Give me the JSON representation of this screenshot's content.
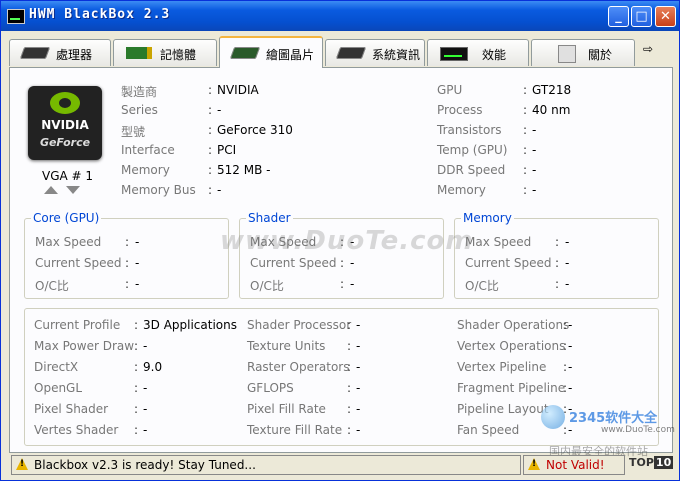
{
  "window": {
    "title": "HWM BlackBox 2.3"
  },
  "tabs": [
    {
      "label": "處理器",
      "icon": "cpu-chip-icon"
    },
    {
      "label": "記憶體",
      "icon": "ram-module-icon"
    },
    {
      "label": "繪圖晶片",
      "icon": "gpu-card-icon",
      "active": true
    },
    {
      "label": "系統資訊",
      "icon": "motherboard-icon"
    },
    {
      "label": "效能",
      "icon": "performance-monitor-icon"
    },
    {
      "label": "關於",
      "icon": "about-document-icon"
    }
  ],
  "gpu_header": {
    "logo_line1": "NVIDIA",
    "logo_line2": "GeForce",
    "vga_label": "VGA # 1",
    "left": [
      {
        "label": "製造商",
        "value": "NVIDIA"
      },
      {
        "label": "Series",
        "value": "-"
      },
      {
        "label": "型號",
        "value": "GeForce 310"
      },
      {
        "label": "Interface",
        "value": "PCI"
      },
      {
        "label": "Memory",
        "value": "512 MB -"
      },
      {
        "label": "Memory Bus",
        "value": "-"
      }
    ],
    "right": [
      {
        "label": "GPU",
        "value": "GT218"
      },
      {
        "label": "Process",
        "value": "40 nm"
      },
      {
        "label": "Transistors",
        "value": "-"
      },
      {
        "label": "Temp (GPU)",
        "value": "-"
      },
      {
        "label": "DDR Speed",
        "value": "-"
      },
      {
        "label": "Memory",
        "value": "-"
      }
    ]
  },
  "clock_groups": [
    {
      "title": "Core (GPU)",
      "rows": [
        {
          "label": "Max Speed",
          "value": "-"
        },
        {
          "label": "Current Speed",
          "value": "-"
        },
        {
          "label": "O/C比",
          "value": "-"
        }
      ]
    },
    {
      "title": "Shader",
      "rows": [
        {
          "label": "Max Speed",
          "value": "-"
        },
        {
          "label": "Current Speed",
          "value": "-"
        },
        {
          "label": "O/C比",
          "value": "-"
        }
      ]
    },
    {
      "title": "Memory",
      "rows": [
        {
          "label": "Max Speed",
          "value": "-"
        },
        {
          "label": "Current Speed",
          "value": "-"
        },
        {
          "label": "O/C比",
          "value": "-"
        }
      ]
    }
  ],
  "details": [
    [
      {
        "label": "Current Profile",
        "value": "3D Applications"
      },
      {
        "label": "Max Power Draw",
        "value": "-"
      },
      {
        "label": "DirectX",
        "value": "9.0"
      },
      {
        "label": "OpenGL",
        "value": "-"
      },
      {
        "label": "Pixel Shader",
        "value": "-"
      },
      {
        "label": "Vertes Shader",
        "value": "-"
      }
    ],
    [
      {
        "label": "Shader Processor",
        "value": "-"
      },
      {
        "label": "Texture Units",
        "value": "-"
      },
      {
        "label": "Raster Operators",
        "value": "-"
      },
      {
        "label": "GFLOPS",
        "value": "-"
      },
      {
        "label": "Pixel Fill Rate",
        "value": "-"
      },
      {
        "label": "Texture Fill Rate",
        "value": "-"
      }
    ],
    [
      {
        "label": "Shader Operations",
        "value": "-"
      },
      {
        "label": "Vertex Operations",
        "value": "-"
      },
      {
        "label": "Vertex Pipeline",
        "value": "-"
      },
      {
        "label": "Fragment Pipeline",
        "value": "-"
      },
      {
        "label": "Pipeline Layout",
        "value": "-"
      },
      {
        "label": "Fan Speed",
        "value": "-"
      }
    ]
  ],
  "watermark": "www.DuoTe.com",
  "site_watermark": {
    "brand": "2345软件大全",
    "url": "www.DuoTe.com",
    "slogan": "国内最安全的软件站"
  },
  "status": {
    "message": "Blackbox v2.3 is ready! Stay Tuned...",
    "validity": "Not Valid!",
    "badge_prefix": "TOP",
    "badge_number": "10"
  },
  "colors": {
    "titlebar": "#0a5be0",
    "group_title": "#0046d5",
    "active_tab_accent": "#f5b53f",
    "invalid_text": "#c00000",
    "nvidia_green": "#76b900"
  }
}
